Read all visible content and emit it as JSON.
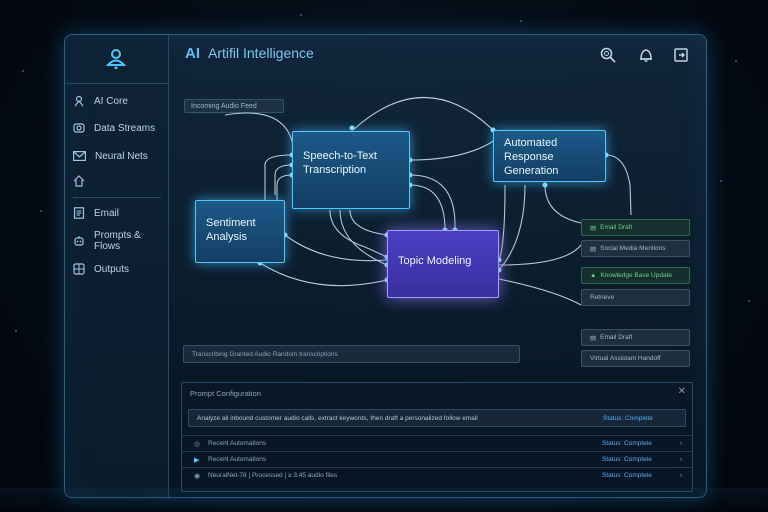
{
  "app": {
    "logo_text": "AI",
    "title": "Artifil Intelligence"
  },
  "sidebar": {
    "items": [
      {
        "label": "AI Core",
        "icon": "chip-icon"
      },
      {
        "label": "Data Streams",
        "icon": "camera-icon"
      },
      {
        "label": "Neural Nets",
        "icon": "mail-icon"
      },
      {
        "label": "",
        "icon": "home-icon"
      },
      {
        "label": "Email",
        "icon": "document-icon"
      },
      {
        "label": "Prompts & Flows",
        "icon": "robot-icon"
      },
      {
        "label": "Outputs",
        "icon": "grid-icon"
      }
    ]
  },
  "header": {
    "icons": [
      "search-icon",
      "bell-icon",
      "logout-icon"
    ]
  },
  "canvas": {
    "feed_label": "Incoming Audio Feed",
    "nodes": {
      "speech": "Speech-to-Text Transcription",
      "response": "Automated Response Generation",
      "sentiment": "Sentiment Analysis",
      "topic": "Topic Modeling"
    },
    "status_strip": "Transcribing Granted Audio Random transcriptions"
  },
  "outputs": [
    {
      "label": "Email Draft",
      "style": "green"
    },
    {
      "label": "Social Media Mentions",
      "style": "gray"
    },
    {
      "label": "Knowledge Base Update",
      "style": "green"
    },
    {
      "label": "Retrieve",
      "style": "gray"
    },
    {
      "label": "Email Draft",
      "style": "gray"
    },
    {
      "label": "Virtual Assistant Handoff",
      "style": "gray"
    }
  ],
  "prompt_panel": {
    "title": "Prompt Configuration",
    "prompt_text": "Analyze all inbound customer audio calls, extract keywords, then draft a personalized follow email",
    "prompt_status": "Status: Complete",
    "rows": [
      {
        "icon": "◎",
        "label": "Recent Automations",
        "status": "Status: Complete"
      },
      {
        "icon": "▶",
        "label": "Recent Automations",
        "status": "Status: Complete"
      },
      {
        "icon": "◉",
        "label": "NeuralNet-78   |   Processed   |   ≥ 3.45 audio files",
        "status": "Status: Complete"
      }
    ]
  },
  "colors": {
    "accent": "#4fc6ff",
    "purple": "#a89bff",
    "green": "#6ed08a"
  }
}
